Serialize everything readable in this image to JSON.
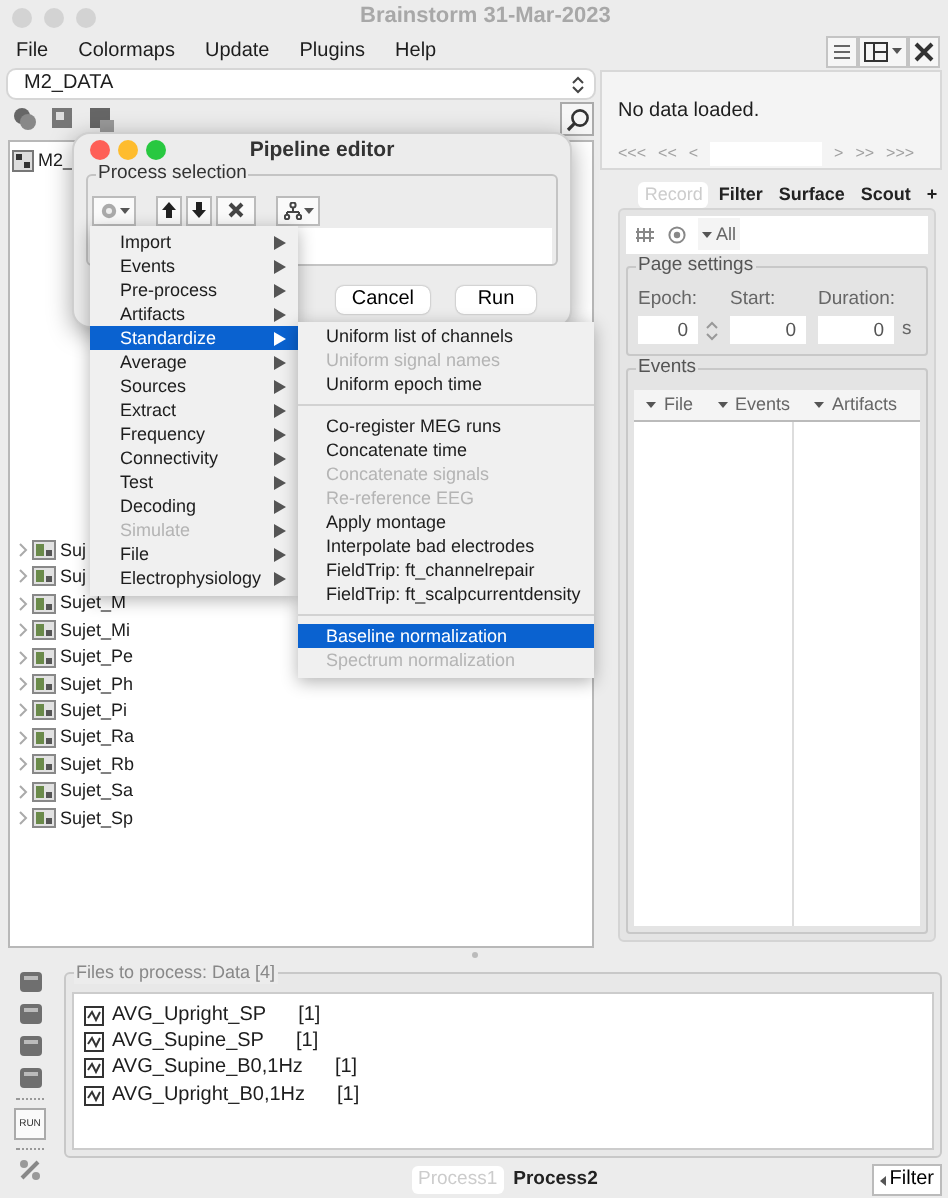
{
  "window": {
    "title": "Brainstorm 31-Mar-2023"
  },
  "menu_bar": [
    "File",
    "Colormaps",
    "Update",
    "Plugins",
    "Help"
  ],
  "protocol_selector": {
    "value": "M2_DATA"
  },
  "tree": {
    "root": "M2_",
    "items": [
      {
        "label": "Suj"
      },
      {
        "label": "Suj"
      },
      {
        "label": "Sujet_M"
      },
      {
        "label": "Sujet_Mi"
      },
      {
        "label": "Sujet_Pe"
      },
      {
        "label": "Sujet_Ph"
      },
      {
        "label": "Sujet_Pi"
      },
      {
        "label": "Sujet_Ra"
      },
      {
        "label": "Sujet_Rb"
      },
      {
        "label": "Sujet_Sa"
      },
      {
        "label": "Sujet_Sp"
      }
    ]
  },
  "viewer": {
    "message": "No data loaded.",
    "nav_back": [
      "<<<",
      "<<",
      "<"
    ],
    "nav_forward": [
      ">",
      ">>",
      ">>>"
    ]
  },
  "record_tabs": [
    {
      "label": "Record",
      "selected": true
    },
    {
      "label": "Filter",
      "selected": false
    },
    {
      "label": "Surface",
      "selected": false
    },
    {
      "label": "Scout",
      "selected": false
    },
    {
      "label": "+",
      "selected": false
    }
  ],
  "record_toolbar": {
    "filter_label": "All"
  },
  "page_settings": {
    "title": "Page settings",
    "fields": [
      {
        "label": "Epoch:",
        "value": "0",
        "kind": "spinner"
      },
      {
        "label": "Start:",
        "value": "0",
        "kind": "text"
      },
      {
        "label": "Duration:",
        "value": "0",
        "kind": "text",
        "unit": "s"
      }
    ]
  },
  "events": {
    "title": "Events",
    "menus": [
      "File",
      "Events",
      "Artifacts"
    ]
  },
  "pipeline_editor": {
    "title": "Pipeline editor",
    "group_title": "Process selection",
    "buttons": [
      "Cancel",
      "Run"
    ]
  },
  "process_menu": {
    "items": [
      {
        "label": "Import",
        "selected": false,
        "disabled": false
      },
      {
        "label": "Events",
        "selected": false,
        "disabled": false
      },
      {
        "label": "Pre-process",
        "selected": false,
        "disabled": false
      },
      {
        "label": "Artifacts",
        "selected": false,
        "disabled": false
      },
      {
        "label": "Standardize",
        "selected": true,
        "disabled": false
      },
      {
        "label": "Average",
        "selected": false,
        "disabled": false
      },
      {
        "label": "Sources",
        "selected": false,
        "disabled": false
      },
      {
        "label": "Extract",
        "selected": false,
        "disabled": false
      },
      {
        "label": "Frequency",
        "selected": false,
        "disabled": false
      },
      {
        "label": "Connectivity",
        "selected": false,
        "disabled": false
      },
      {
        "label": "Test",
        "selected": false,
        "disabled": false
      },
      {
        "label": "Decoding",
        "selected": false,
        "disabled": false
      },
      {
        "label": "Simulate",
        "selected": false,
        "disabled": true
      },
      {
        "label": "File",
        "selected": false,
        "disabled": false
      },
      {
        "label": "Electrophysiology",
        "selected": false,
        "disabled": false
      }
    ]
  },
  "submenu": {
    "groups": [
      [
        {
          "label": "Uniform list of channels",
          "selected": false,
          "disabled": false
        },
        {
          "label": "Uniform signal names",
          "selected": false,
          "disabled": true
        },
        {
          "label": "Uniform epoch time",
          "selected": false,
          "disabled": false
        }
      ],
      [
        {
          "label": "Co-register MEG runs",
          "selected": false,
          "disabled": false
        },
        {
          "label": "Concatenate time",
          "selected": false,
          "disabled": false
        },
        {
          "label": "Concatenate signals",
          "selected": false,
          "disabled": true
        },
        {
          "label": "Re-reference EEG",
          "selected": false,
          "disabled": true
        },
        {
          "label": "Apply montage",
          "selected": false,
          "disabled": false
        },
        {
          "label": "Interpolate bad electrodes",
          "selected": false,
          "disabled": false
        },
        {
          "label": "FieldTrip: ft_channelrepair",
          "selected": false,
          "disabled": false
        },
        {
          "label": "FieldTrip: ft_scalpcurrentdensity",
          "selected": false,
          "disabled": false
        }
      ],
      [
        {
          "label": "Baseline normalization",
          "selected": true,
          "disabled": false
        },
        {
          "label": "Spectrum normalization",
          "selected": false,
          "disabled": true
        }
      ]
    ]
  },
  "process_panel": {
    "side_button": "RUN",
    "title": "Files to process: Data [4]",
    "files": [
      {
        "name": "AVG_Upright_SP",
        "count": "[1]"
      },
      {
        "name": "AVG_Supine_SP",
        "count": "[1]"
      },
      {
        "name": "AVG_Supine_B0,1Hz",
        "count": "[1]"
      },
      {
        "name": "AVG_Upright_B0,1Hz",
        "count": "[1]"
      }
    ],
    "tabs": [
      {
        "label": "Process1",
        "selected": true
      },
      {
        "label": "Process2",
        "selected": false
      }
    ],
    "filter_button": "Filter"
  }
}
